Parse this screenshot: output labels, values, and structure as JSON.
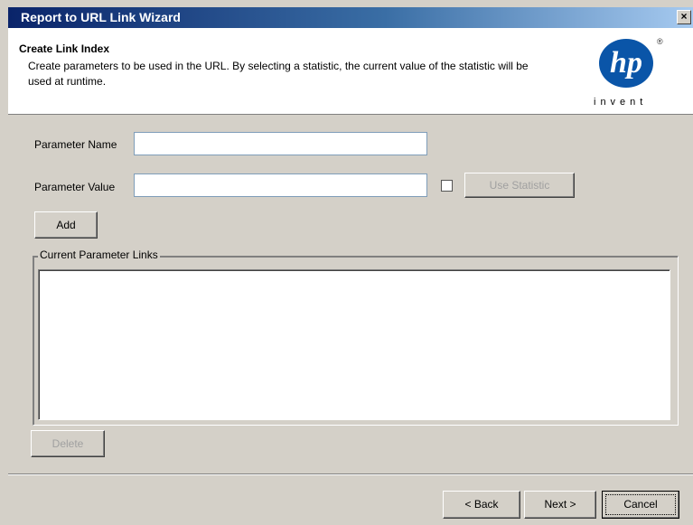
{
  "window": {
    "title": "Report to URL Link Wizard",
    "close_glyph": "×"
  },
  "header": {
    "title": "Create Link Index",
    "description": "Create parameters to be used in the URL. By selecting a statistic, the current value of the statistic will be used at runtime.",
    "logo": {
      "mark": "hp",
      "tagline": "invent",
      "registered": "®"
    }
  },
  "form": {
    "param_name_label": "Parameter Name",
    "param_name_value": "",
    "param_value_label": "Parameter Value",
    "param_value_value": "",
    "use_statistic_checked": false,
    "use_statistic_label": "Use Statistic",
    "add_label": "Add"
  },
  "links_group": {
    "legend": "Current Parameter Links",
    "items": []
  },
  "delete_label": "Delete",
  "footer": {
    "back_label": "< Back",
    "next_label": "Next >",
    "cancel_label": "Cancel"
  },
  "colors": {
    "titlebar_start": "#0a246a",
    "titlebar_end": "#a6caf0",
    "logo_blue": "#0a55a8",
    "dialog_bg": "#d4d0c8"
  }
}
